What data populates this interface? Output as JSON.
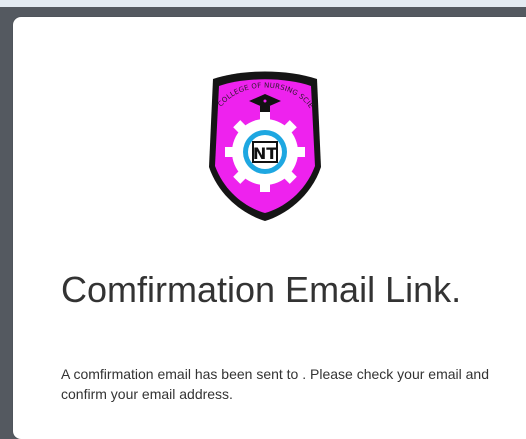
{
  "confirmation": {
    "heading": "Comfirmation Email Link.",
    "message": "A comfirmation email has been sent to . Please check your email and confirm your email address."
  },
  "logo": {
    "icon": "school-crest-logo",
    "arc_text": "COLLEGE OF NURSING SCIENCE & TECHNOLOGY",
    "monogram": "NT",
    "colors": {
      "shield_fill": "#ee22ee",
      "shield_border": "#151515",
      "gear": "#ffffff",
      "ring": "#1ea7e1"
    }
  }
}
